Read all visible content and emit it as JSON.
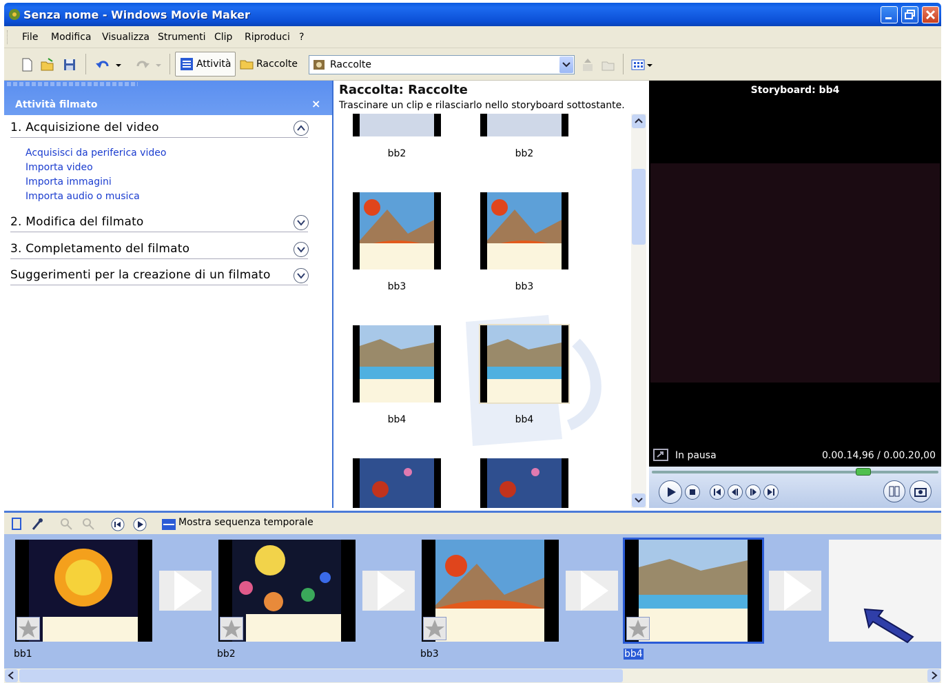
{
  "window": {
    "title": "Senza nome - Windows Movie Maker"
  },
  "menu": [
    "File",
    "Modifica",
    "Visualizza",
    "Strumenti",
    "Clip",
    "Riproduci",
    "?"
  ],
  "toolbar": {
    "tasks_label": "Attività",
    "collections_label": "Raccolte",
    "combo_value": "Raccolte"
  },
  "taskpane": {
    "header": "Attività filmato",
    "close": "×",
    "sections": [
      {
        "title": "1. Acquisizione del video",
        "expanded": true,
        "links": [
          "Acquisisci da periferica video",
          "Importa video",
          "Importa immagini",
          "Importa audio o musica"
        ]
      },
      {
        "title": "2. Modifica del filmato",
        "expanded": false
      },
      {
        "title": "3. Completamento del filmato",
        "expanded": false
      },
      {
        "title": "Suggerimenti per la creazione di un filmato",
        "expanded": false
      }
    ]
  },
  "collection": {
    "title": "Raccolta: Raccolte",
    "subtitle": "Trascinare un clip e rilasciarlo nello storyboard sottostante.",
    "clips": [
      "bb2",
      "bb2",
      "bb3",
      "bb3",
      "bb4",
      "bb4"
    ]
  },
  "preview": {
    "title": "Storyboard: bb4",
    "status": "In pausa",
    "time": "0.00.14,96 / 0.00.20,00"
  },
  "storyboard_toolbar": {
    "timeline_label": "Mostra sequenza temporale"
  },
  "storyboard": {
    "clips": [
      "bb1",
      "bb2",
      "bb3",
      "bb4"
    ],
    "selected": "bb4"
  },
  "colors": {
    "titlebar": "#0b4fd6",
    "taskpane_header": "#5b8ff0",
    "storyboard_bg": "#a4bdea",
    "link": "#1a3ccf"
  }
}
